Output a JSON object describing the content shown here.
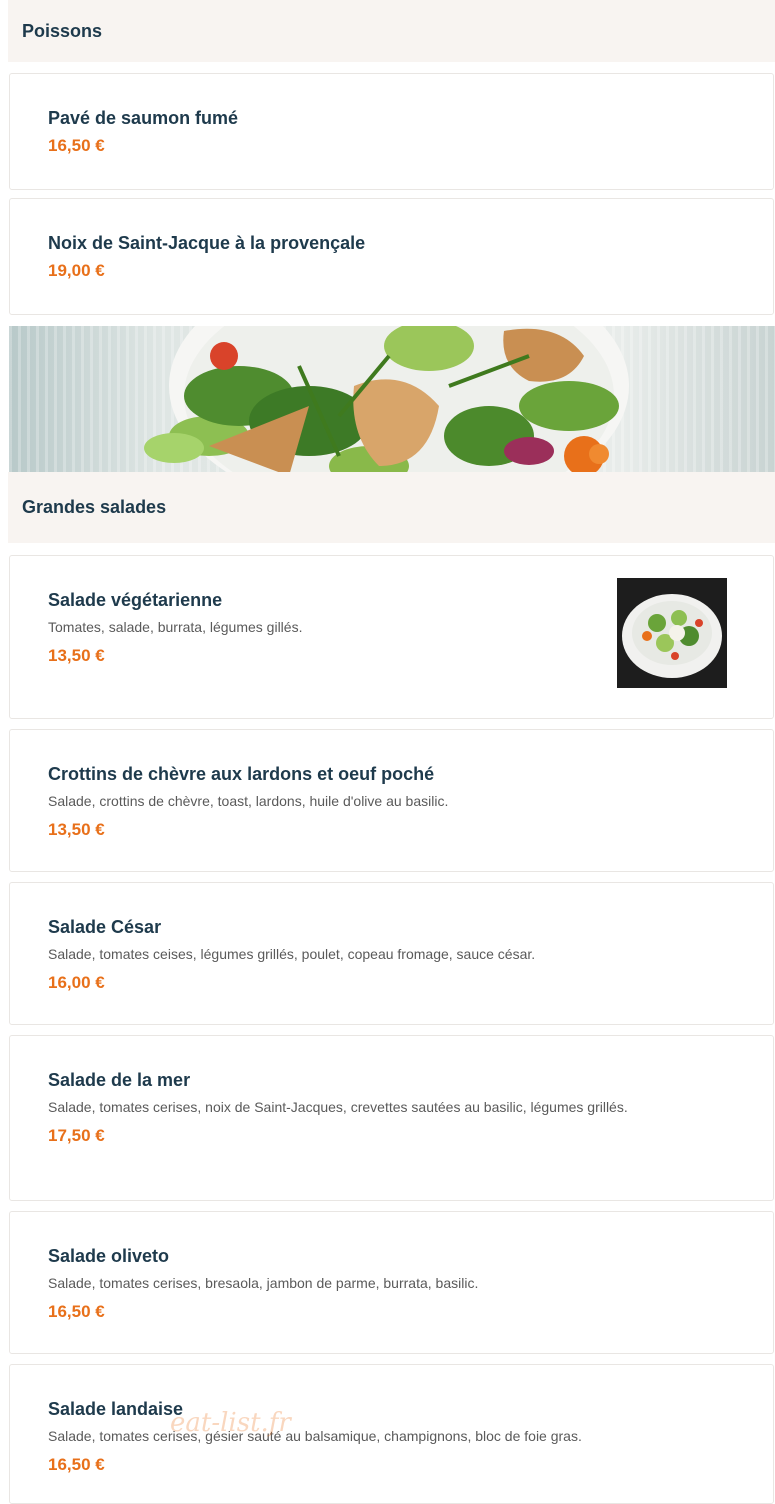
{
  "sections": {
    "poissons": {
      "title": "Poissons",
      "items": [
        {
          "name": "Pavé de saumon fumé",
          "price": "16,50 €"
        },
        {
          "name": "Noix de Saint-Jacque à la provençale",
          "price": "19,00 €"
        }
      ]
    },
    "grandes_salades": {
      "title": "Grandes salades",
      "items": [
        {
          "name": "Salade végétarienne",
          "description": "Tomates, salade, burrata, légumes gillés.",
          "price": "13,50 €"
        },
        {
          "name": "Crottins de chèvre aux lardons et oeuf poché",
          "description": "Salade, crottins de chèvre, toast, lardons, huile d'olive au basilic.",
          "price": "13,50 €"
        },
        {
          "name": "Salade César",
          "description": "Salade, tomates ceises, légumes grillés, poulet, copeau fromage, sauce césar.",
          "price": "16,00 €"
        },
        {
          "name": "Salade de la mer",
          "description": "Salade, tomates cerises, noix de Saint-Jacques, crevettes sautées au basilic, légumes grillés.",
          "price": "17,50 €"
        },
        {
          "name": "Salade oliveto",
          "description": "Salade, tomates cerises, bresaola, jambon de parme, burrata, basilic.",
          "price": "16,50 €"
        },
        {
          "name": "Salade landaise",
          "description": "Salade, tomates cerises, gésier sauté au balsamique, champignons, bloc de foie gras.",
          "price": "16,50 €"
        }
      ]
    }
  },
  "watermark": "eat-list.fr",
  "colors": {
    "price": "#e8701a",
    "title": "#1e3a4c",
    "section_bg": "#f8f4f1"
  }
}
